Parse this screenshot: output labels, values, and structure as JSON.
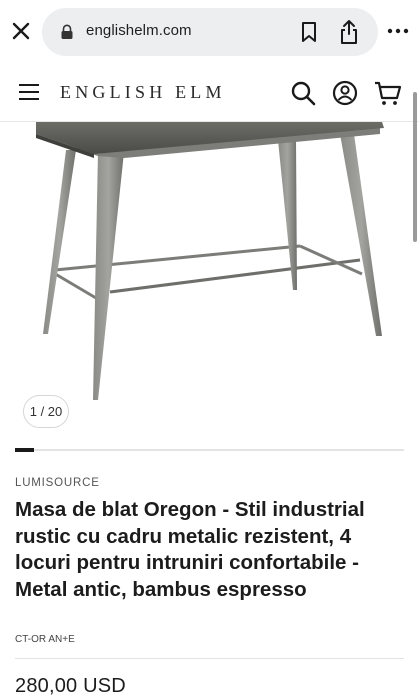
{
  "browser": {
    "url": "englishelm.com",
    "icons": [
      "close-icon",
      "lock-icon",
      "bookmark-icon",
      "share-icon",
      "more-icon"
    ]
  },
  "header": {
    "logo": "ENGLISH ELM",
    "icons": [
      "menu-icon",
      "search-icon",
      "account-icon",
      "cart-icon"
    ]
  },
  "gallery": {
    "counter": "1 / 20",
    "progress_fraction": 0.05
  },
  "product": {
    "vendor": "LUMISOURCE",
    "title": "Masa de blat Oregon - Stil industrial rustic cu cadru metalic rezistent, 4 locuri pentru intruniri confortabile - Metal antic, bambus espresso",
    "sku": "CT-OR AN+E",
    "price": "280,00 USD"
  }
}
